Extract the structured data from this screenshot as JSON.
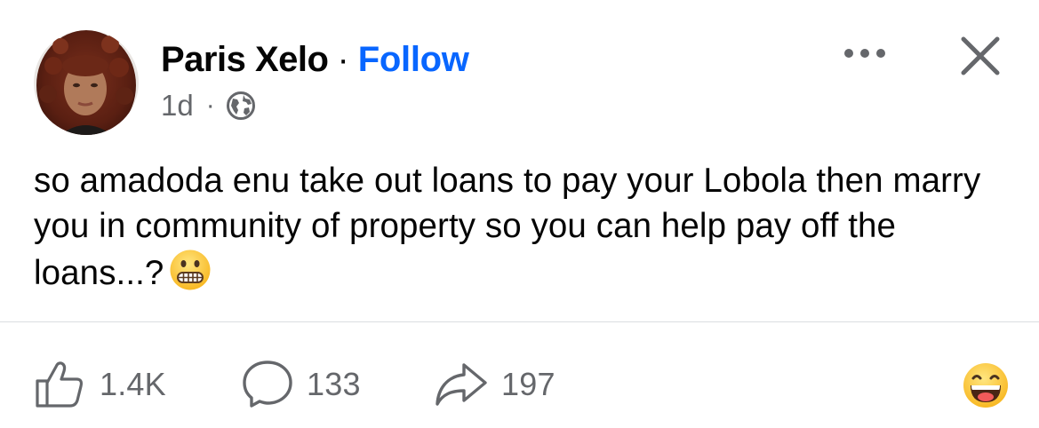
{
  "author": {
    "name": "Paris Xelo",
    "separator": "·",
    "follow_label": "Follow",
    "avatar_icon": "profile-photo"
  },
  "meta": {
    "timestamp": "1d",
    "separator": "·",
    "audience_icon": "globe-icon"
  },
  "header_controls": {
    "more_icon": "more-options-icon",
    "close_icon": "close-icon"
  },
  "post": {
    "text": "so amadoda enu take out loans to pay your Lobola then marry you in community of property so you can help pay off the loans...?",
    "emoji": "grimacing-face-emoji"
  },
  "actions": {
    "likes": "1.4K",
    "comments": "133",
    "shares": "197",
    "like_icon": "thumbs-up-icon",
    "comment_icon": "comment-bubble-icon",
    "share_icon": "share-arrow-icon",
    "reaction_icon": "laughing-face-emoji"
  },
  "colors": {
    "follow": "#0866ff",
    "secondary_text": "#65676b",
    "primary_text": "#050505",
    "divider": "#dadde1"
  }
}
